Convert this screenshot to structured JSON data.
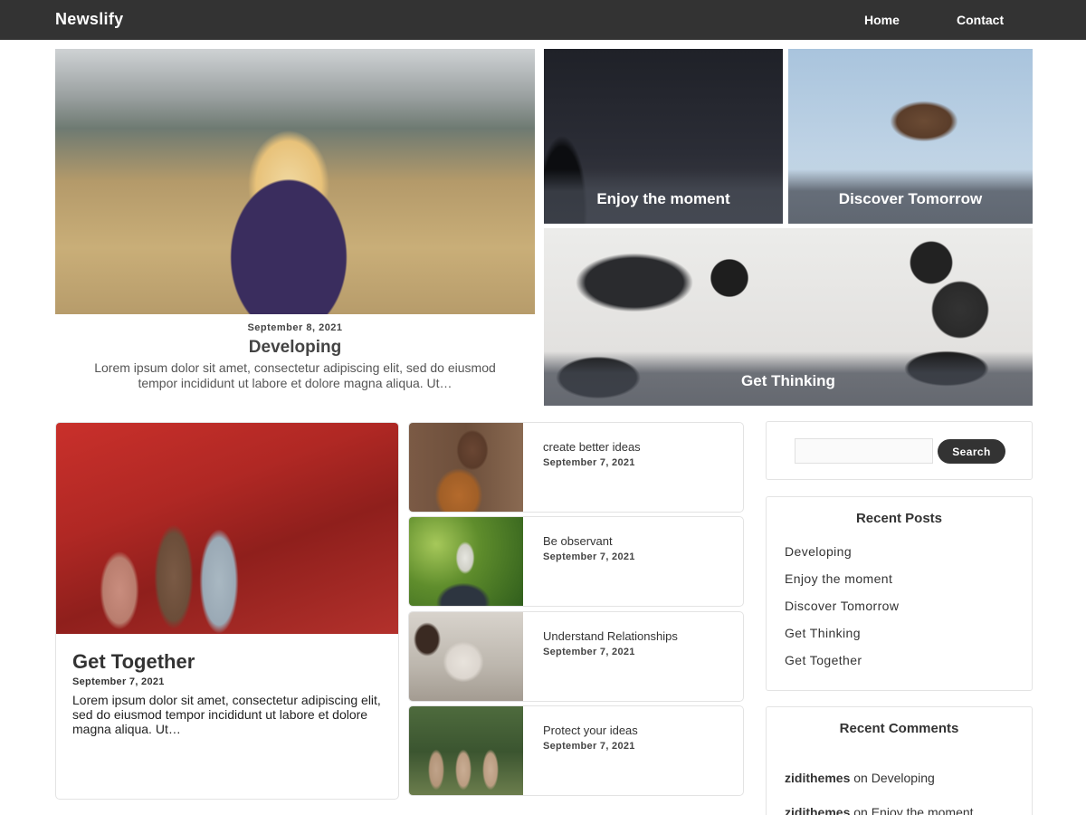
{
  "header": {
    "brand": "Newslify",
    "nav": {
      "home": "Home",
      "contact": "Contact"
    }
  },
  "hero": {
    "date": "September 8, 2021",
    "title": "Developing",
    "excerpt": "Lorem ipsum dolor sit amet, consectetur adipiscing elit, sed do eiusmod tempor incididunt ut labore et dolore magna aliqua. Ut…"
  },
  "tiles": {
    "enjoy": "Enjoy the moment",
    "discover": "Discover Tomorrow",
    "thinking": "Get Thinking"
  },
  "feature": {
    "title": "Get Together",
    "date": "September 7, 2021",
    "excerpt": "Lorem ipsum dolor sit amet, consectetur adipiscing elit, sed do eiusmod tempor incididunt ut labore et dolore magna aliqua. Ut…"
  },
  "list": [
    {
      "title": "create better ideas",
      "date": "September 7, 2021"
    },
    {
      "title": "Be observant",
      "date": "September 7, 2021"
    },
    {
      "title": "Understand Relationships",
      "date": "September 7, 2021"
    },
    {
      "title": "Protect your ideas",
      "date": "September 7, 2021"
    }
  ],
  "sidebar": {
    "search": {
      "value": "",
      "button": "Search"
    },
    "recent_posts": {
      "title": "Recent Posts",
      "items": [
        "Developing",
        "Enjoy the moment",
        "Discover Tomorrow",
        "Get Thinking",
        "Get Together"
      ]
    },
    "recent_comments": {
      "title": "Recent Comments",
      "items": [
        {
          "author": "zidithemes",
          "on": "on",
          "post": "Developing"
        },
        {
          "author": "zidithemes",
          "on": "on",
          "post": "Enjoy the moment"
        }
      ]
    }
  }
}
